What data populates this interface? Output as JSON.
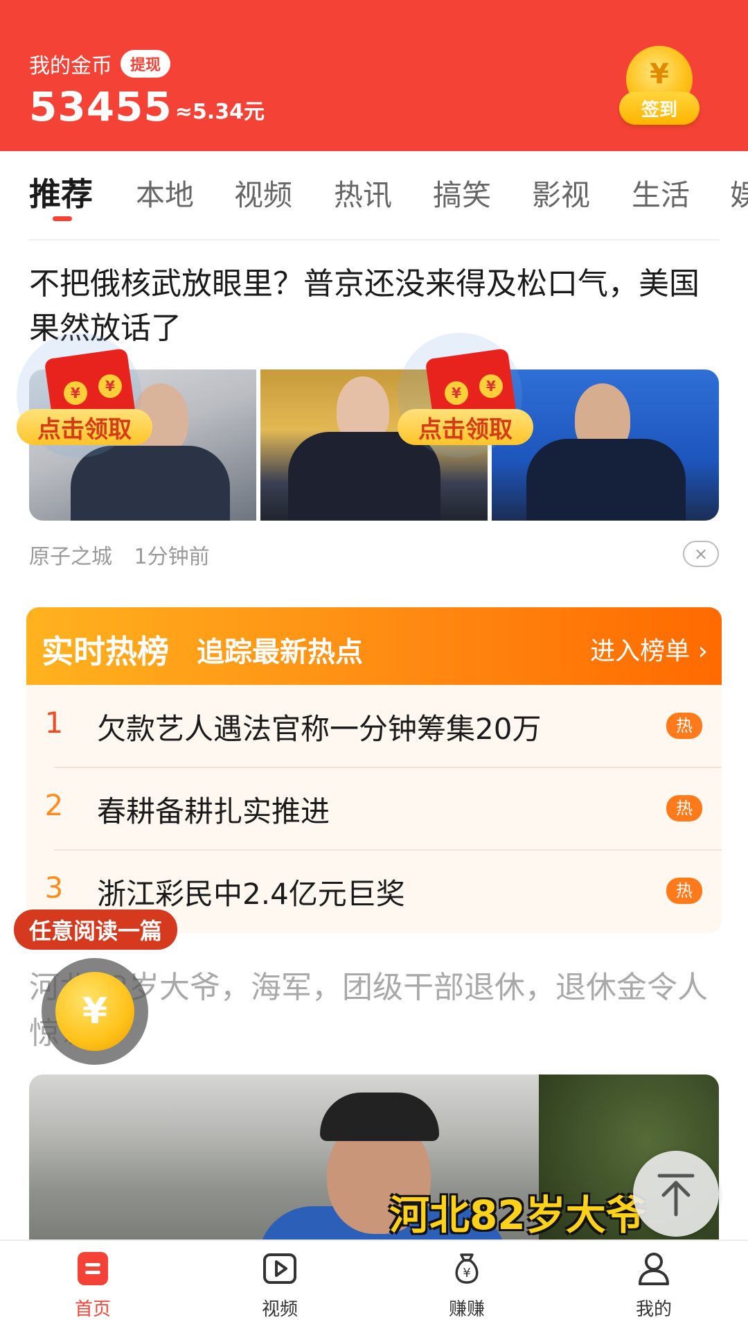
{
  "header": {
    "coin_label": "我的金币",
    "withdraw_label": "提现",
    "coin_count": "53455",
    "coin_yuan": "≈5.34元",
    "signin_label": "签到",
    "signin_symbol": "¥"
  },
  "tabs": [
    {
      "label": "推荐",
      "active": true
    },
    {
      "label": "本地"
    },
    {
      "label": "视频"
    },
    {
      "label": "热讯"
    },
    {
      "label": "搞笑"
    },
    {
      "label": "影视"
    },
    {
      "label": "生活"
    },
    {
      "label": "娱"
    }
  ],
  "article1": {
    "title": "不把俄核武放眼里？普京还没来得及松口气，美国果然放话了",
    "redpack_label": "点击领取",
    "redpack_coin_symbol": "¥",
    "source": "原子之城",
    "time": "1分钟前",
    "close_symbol": "×"
  },
  "hot_list": {
    "title": "实时热榜",
    "subtitle": "追踪最新热点",
    "enter_label": "进入榜单 ›",
    "badge": "热",
    "items": [
      {
        "rank": "1",
        "text": "欠款艺人遇法官称一分钟筹集20万"
      },
      {
        "rank": "2",
        "text": "春耕备耕扎实推进"
      },
      {
        "rank": "3",
        "text": "浙江彩民中2.4亿元巨奖"
      }
    ]
  },
  "article2": {
    "read_pill": "任意阅读一篇",
    "title": "河北82岁大爷，海军，团级干部退休，退休金令人惊讶!",
    "image_caption": "河北82岁大爷",
    "float_coin_symbol": "¥"
  },
  "bottom_nav": [
    {
      "label": "首页",
      "icon": "home-icon",
      "active": true
    },
    {
      "label": "视频",
      "icon": "video-play-icon"
    },
    {
      "label": "赚赚",
      "icon": "money-bag-icon"
    },
    {
      "label": "我的",
      "icon": "person-icon"
    }
  ],
  "colors": {
    "brand_red": "#f44336",
    "hot_orange": "#ff8a12",
    "coin_gold": "#ffc21a"
  }
}
